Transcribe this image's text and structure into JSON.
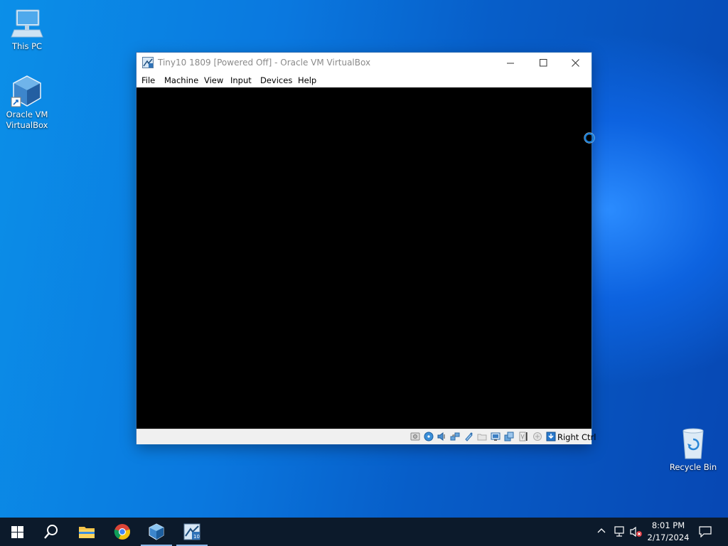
{
  "desktop": {
    "icons": [
      {
        "label": "This PC"
      },
      {
        "label": "Oracle VM VirtualBox"
      },
      {
        "label": "Recycle Bin"
      }
    ]
  },
  "window": {
    "title": "Tiny10 1809 [Powered Off] - Oracle VM VirtualBox",
    "menu": [
      "File",
      "Machine",
      "View",
      "Input",
      "Devices",
      "Help"
    ],
    "status_icons": [
      "hard-disk-icon",
      "optical-drive-icon",
      "audio-icon",
      "network-icon",
      "usb-icon",
      "shared-folders-icon",
      "display-icon",
      "recording-icon",
      "cpu-icon",
      "mouse-integration-icon",
      "keyboard-icon"
    ],
    "host_key": "Right Ctrl"
  },
  "taskbar": {
    "items": [
      "start-icon",
      "search-icon",
      "file-explorer-icon",
      "chrome-icon",
      "virtualbox-icon",
      "vm-window-icon"
    ],
    "time": "8:01 PM",
    "date": "2/17/2024"
  },
  "colors": {
    "taskbar_bg": "#0c1a2b",
    "screen_bg": "#000000",
    "accent": "#0a78df"
  }
}
